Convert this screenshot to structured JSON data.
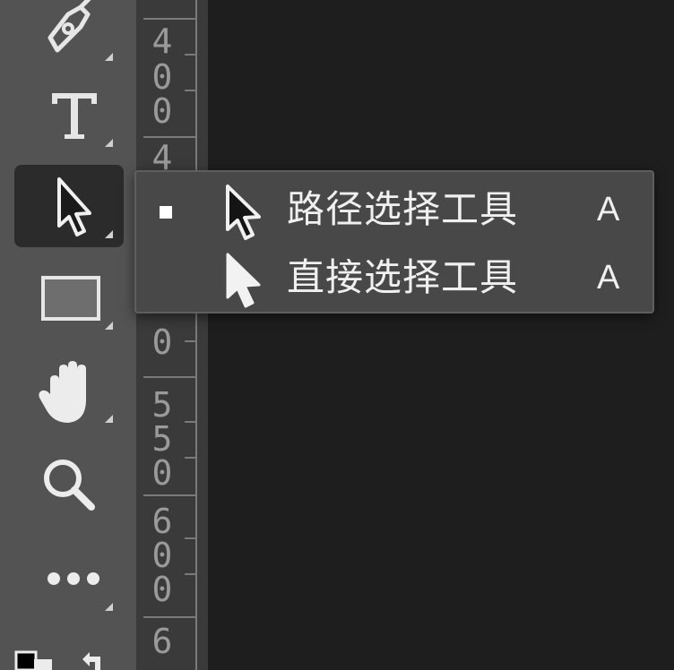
{
  "toolbar": {
    "tools": [
      {
        "name": "pen-tool",
        "icon": "pen-icon",
        "has_submenu": true
      },
      {
        "name": "type-tool",
        "icon": "type-icon",
        "label": "T",
        "has_submenu": true
      },
      {
        "name": "path-selection-tool",
        "icon": "arrow-icon",
        "has_submenu": true,
        "active": true
      },
      {
        "name": "rectangle-tool",
        "icon": "rectangle-icon",
        "has_submenu": true
      },
      {
        "name": "hand-tool",
        "icon": "hand-icon",
        "has_submenu": true
      },
      {
        "name": "zoom-tool",
        "icon": "zoom-icon",
        "has_submenu": false
      },
      {
        "name": "edit-toolbar",
        "icon": "ellipsis-icon",
        "has_submenu": true
      }
    ]
  },
  "ruler": {
    "labels": [
      "4",
      "0",
      "0",
      "4",
      "0",
      "5",
      "5",
      "0",
      "6",
      "0",
      "0",
      "6"
    ]
  },
  "flyout": {
    "items": [
      {
        "label": "路径选择工具",
        "shortcut": "A",
        "checked": true,
        "icon": "black-arrow-icon"
      },
      {
        "label": "直接选择工具",
        "shortcut": "A",
        "checked": false,
        "icon": "white-arrow-icon"
      }
    ]
  },
  "colors": {
    "toolbar_bg": "#535353",
    "canvas_bg": "#1e1e1e",
    "ruler_bg": "#3a3a3a",
    "menu_bg": "#484848",
    "text": "#f0f0f0"
  }
}
